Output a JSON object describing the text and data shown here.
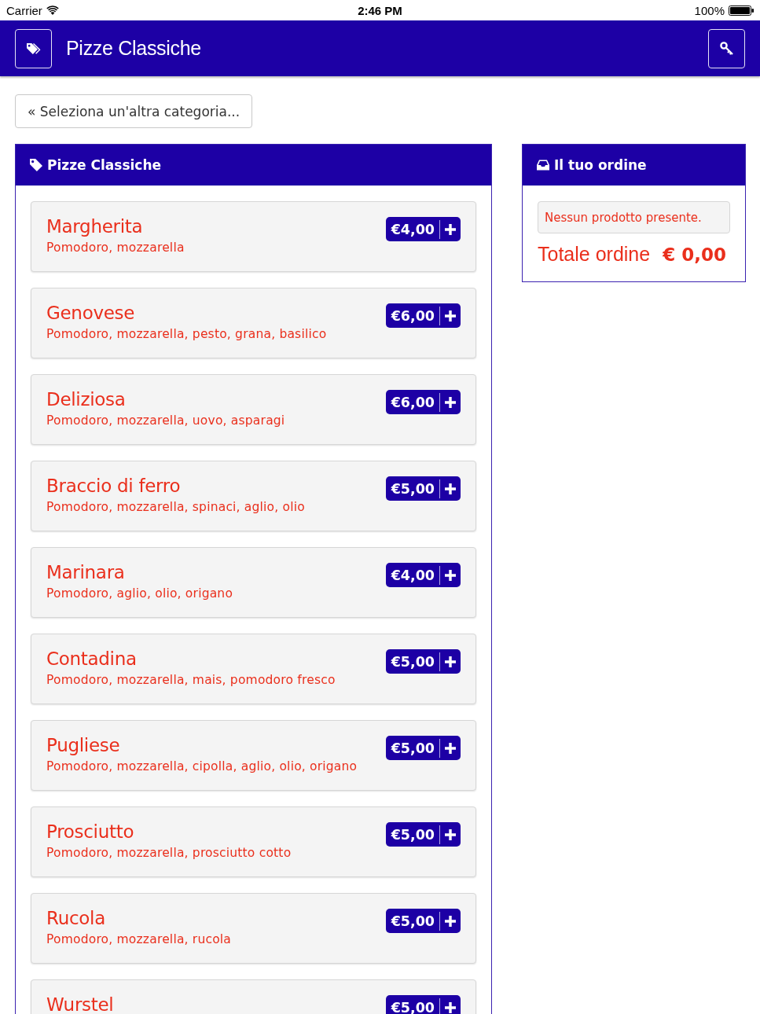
{
  "status_bar": {
    "carrier": "Carrier",
    "time": "2:46 PM",
    "battery": "100%"
  },
  "nav_bar": {
    "title": "Pizze Classiche"
  },
  "back_button": {
    "label": "« Seleziona un'altra categoria..."
  },
  "category_panel": {
    "title": "Pizze Classiche",
    "items": [
      {
        "name": "Margherita",
        "description": "Pomodoro, mozzarella",
        "price": "€4,00"
      },
      {
        "name": "Genovese",
        "description": "Pomodoro, mozzarella, pesto, grana, basilico",
        "price": "€6,00"
      },
      {
        "name": "Deliziosa",
        "description": "Pomodoro, mozzarella, uovo, asparagi",
        "price": "€6,00"
      },
      {
        "name": "Braccio di ferro",
        "description": "Pomodoro, mozzarella, spinaci, aglio, olio",
        "price": "€5,00"
      },
      {
        "name": "Marinara",
        "description": "Pomodoro, aglio, olio, origano",
        "price": "€4,00"
      },
      {
        "name": "Contadina",
        "description": "Pomodoro, mozzarella, mais, pomodoro fresco",
        "price": "€5,00"
      },
      {
        "name": "Pugliese",
        "description": "Pomodoro, mozzarella, cipolla, aglio, olio, origano",
        "price": "€5,00"
      },
      {
        "name": "Prosciutto",
        "description": "Pomodoro, mozzarella, prosciutto cotto",
        "price": "€5,00"
      },
      {
        "name": "Rucola",
        "description": "Pomodoro, mozzarella, rucola",
        "price": "€5,00"
      },
      {
        "name": "Wurstel",
        "price": "€5,00"
      }
    ]
  },
  "order_panel": {
    "title": "Il tuo ordine",
    "empty_message": "Nessun prodotto presente.",
    "total_label": "Totale ordine",
    "total": "€ 0,00"
  }
}
